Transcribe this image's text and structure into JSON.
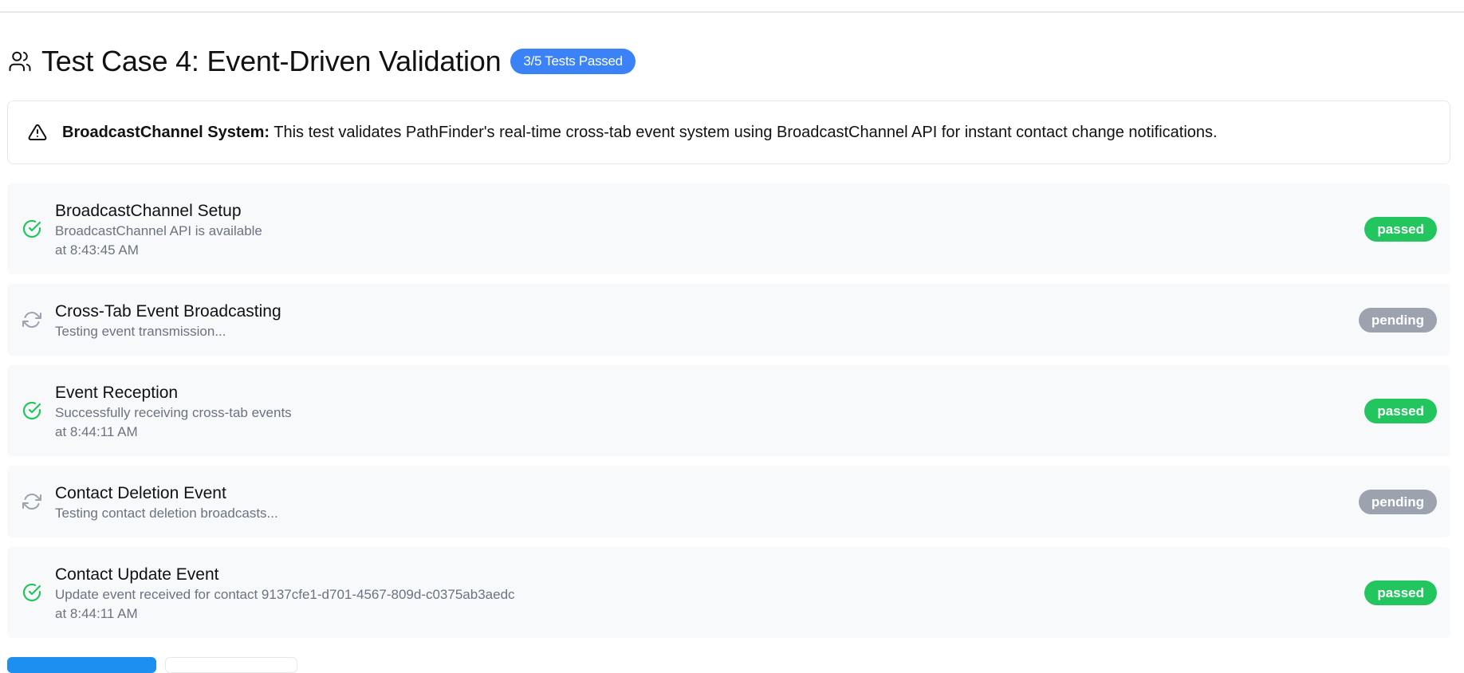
{
  "header": {
    "title": "Test Case 4: Event-Driven Validation",
    "badge": "3/5 Tests Passed",
    "icon": "users-icon"
  },
  "alert": {
    "icon": "warning-triangle-icon",
    "title": "BroadcastChannel System:",
    "message": " This test validates PathFinder's real-time cross-tab event system using BroadcastChannel API for instant contact change notifications."
  },
  "tests": [
    {
      "title": "BroadcastChannel Setup",
      "description": "BroadcastChannel API is available",
      "time": "at 8:43:45 AM",
      "status": "passed",
      "icon": "check-circle-icon"
    },
    {
      "title": "Cross-Tab Event Broadcasting",
      "description": "Testing event transmission...",
      "time": "",
      "status": "pending",
      "icon": "refresh-icon"
    },
    {
      "title": "Event Reception",
      "description": "Successfully receiving cross-tab events",
      "time": "at 8:44:11 AM",
      "status": "passed",
      "icon": "check-circle-icon"
    },
    {
      "title": "Contact Deletion Event",
      "description": "Testing contact deletion broadcasts...",
      "time": "",
      "status": "pending",
      "icon": "refresh-icon"
    },
    {
      "title": "Contact Update Event",
      "description": "Update event received for contact 9137cfe1-d701-4567-809d-c0375ab3aedc",
      "time": "at 8:44:11 AM",
      "status": "passed",
      "icon": "check-circle-icon"
    }
  ],
  "colors": {
    "accent": "#3b82f6",
    "passed": "#22c55e",
    "pending": "#9ca3af"
  }
}
